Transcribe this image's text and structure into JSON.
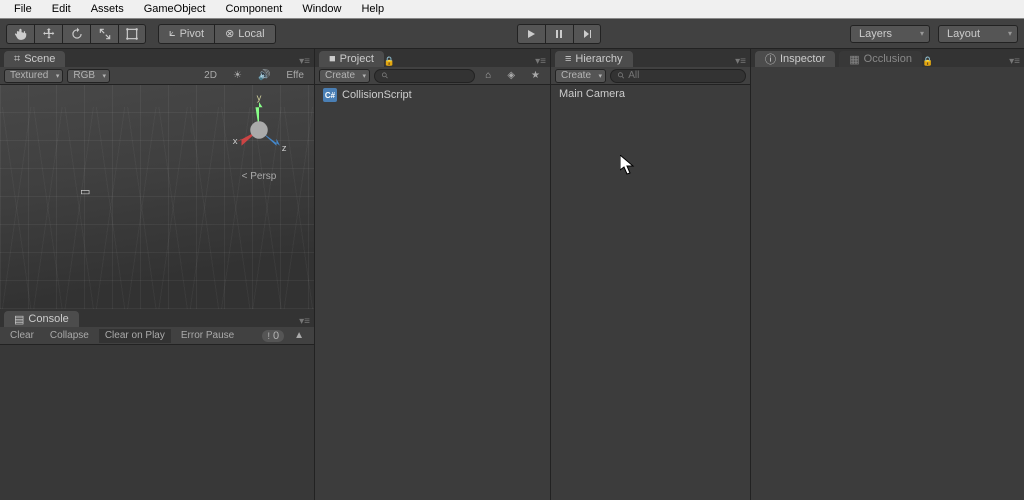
{
  "menu": [
    "File",
    "Edit",
    "Assets",
    "GameObject",
    "Component",
    "Window",
    "Help"
  ],
  "toolbar": {
    "pivot": "Pivot",
    "local": "Local",
    "layers": "Layers",
    "layout": "Layout"
  },
  "scene": {
    "tab": "Scene",
    "shaded": "Textured",
    "rgb": "RGB",
    "twoD": "2D",
    "effects": "Effe",
    "persp": "Persp",
    "axis": {
      "x": "x",
      "y": "y",
      "z": "z"
    }
  },
  "console": {
    "tab": "Console",
    "clear": "Clear",
    "collapse": "Collapse",
    "clearOnPlay": "Clear on Play",
    "errorPause": "Error Pause",
    "errorCount": "0"
  },
  "project": {
    "tab": "Project",
    "create": "Create",
    "items": [
      "CollisionScript"
    ]
  },
  "hierarchy": {
    "tab": "Hierarchy",
    "create": "Create",
    "searchFilter": "All",
    "items": [
      "Main Camera"
    ]
  },
  "inspector": {
    "tab": "Inspector"
  },
  "occlusion": {
    "tab": "Occlusion"
  }
}
